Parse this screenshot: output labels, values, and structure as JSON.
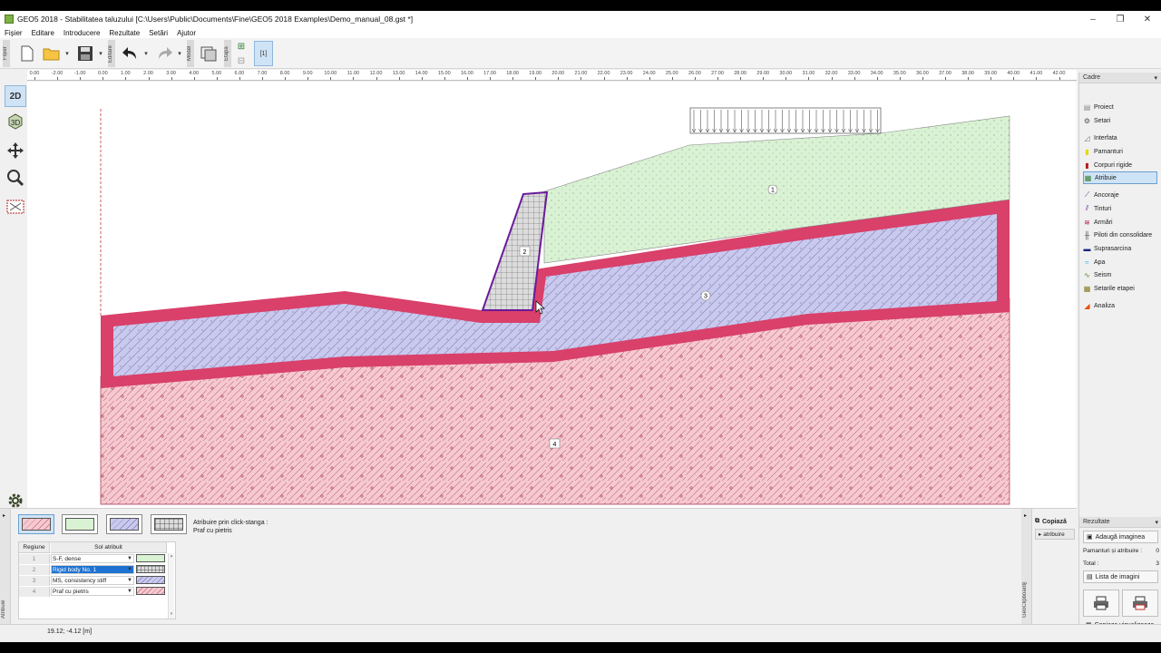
{
  "window": {
    "title": "GEO5 2018 - Stabilitatea taluzului [C:\\Users\\Public\\Documents\\Fine\\GEO5 2018 Examples\\Demo_manual_08.gst *]",
    "minimize": "–",
    "maximize": "❐",
    "close": "✕"
  },
  "menu": [
    "Fișier",
    "Editare",
    "Introducere",
    "Rezultate",
    "Setări",
    "Ajutor"
  ],
  "toolbar": {
    "group_file": "Fișier",
    "group_edit": "Editare",
    "group_model": "Model",
    "group_stage": "Etapă",
    "stage_label": "[1]"
  },
  "ruler": {
    "ticks": [
      "0.00",
      "-2.00",
      "-1.00",
      "0.00",
      "1.00",
      "2.00",
      "3.00",
      "4.00",
      "5.00",
      "6.00",
      "7.00",
      "8.00",
      "9.00",
      "10.00",
      "11.00",
      "12.00",
      "13.00",
      "14.00",
      "15.00",
      "16.00",
      "17.00",
      "18.00",
      "19.00",
      "20.00",
      "21.00",
      "22.00",
      "23.00",
      "24.00",
      "25.00",
      "26.00",
      "27.00",
      "28.00",
      "29.00",
      "30.00",
      "31.00",
      "32.00",
      "33.00",
      "34.00",
      "35.00",
      "36.00",
      "37.00",
      "38.00",
      "39.00",
      "40.00",
      "41.00",
      "42.00",
      "[m]"
    ]
  },
  "left_tools": {
    "view2d": "2D",
    "view3d": "3D"
  },
  "canvas": {
    "region_labels": [
      "1",
      "2",
      "3",
      "4"
    ]
  },
  "right_panel": {
    "header": "Cadre",
    "items": [
      {
        "label": "Proiect",
        "icon": "document-icon",
        "color": "#8a8a8a"
      },
      {
        "label": "Setari",
        "icon": "gear-icon",
        "color": "#555555"
      },
      {
        "label": "Interfata",
        "icon": "interface-icon",
        "color": "#777777"
      },
      {
        "label": "Pamanturi",
        "icon": "soils-icon",
        "color": "#e6d800"
      },
      {
        "label": "Corpuri rigide",
        "icon": "rigid-body-icon",
        "color": "#b71c1c"
      },
      {
        "label": "Atribuie",
        "icon": "assign-icon",
        "color": "#3a7d2c"
      },
      {
        "label": "Ancoraje",
        "icon": "anchor-icon",
        "color": "#6a1b9a"
      },
      {
        "label": "Tinturi",
        "icon": "nail-icon",
        "color": "#6a1b9a"
      },
      {
        "label": "Armări",
        "icon": "reinforcement-icon",
        "color": "#ad1457"
      },
      {
        "label": "Piloti din consolidare",
        "icon": "piles-icon",
        "color": "#444444"
      },
      {
        "label": "Suprasarcina",
        "icon": "surcharge-icon",
        "color": "#1a237e"
      },
      {
        "label": "Apa",
        "icon": "water-icon",
        "color": "#29b6f6"
      },
      {
        "label": "Seism",
        "icon": "earthquake-icon",
        "color": "#558b2f"
      },
      {
        "label": "Setarile etapei",
        "icon": "stage-settings-icon",
        "color": "#827717"
      },
      {
        "label": "Analiza",
        "icon": "analysis-icon",
        "color": "#e65100"
      }
    ],
    "results_header": "Rezultate",
    "add_image": "Adaugă imaginea",
    "soils_assign_label": "Pamanturi și atribuire :",
    "soils_assign_value": "0",
    "total_label": "Total :",
    "total_value": "3",
    "image_list": "Lista de imagini",
    "copy_view": "Copiaza vizualizeaza"
  },
  "bottom_panel": {
    "side_label": "Atribuie",
    "hint_line1": "Atribuire prin click-stanga :",
    "hint_line2": "Praf cu pietris",
    "table_header_region": "Regiune",
    "table_header_soil": "Sol atribuit",
    "rows": [
      {
        "num": "1",
        "soil": "S-F, dense"
      },
      {
        "num": "2",
        "soil": "Rigid body No. 1"
      },
      {
        "num": "3",
        "soil": "MS, consistency stiff"
      },
      {
        "num": "4",
        "soil": "Praf cu pietris"
      }
    ],
    "copy_title": "Copiază",
    "copy_btn": "atribuire",
    "clipboard_label": "GeoClipboard™"
  },
  "status": {
    "coords": "19.12; -4.12 [m]"
  },
  "colors": {
    "soil1": "#d9f2d3",
    "soil3": "#c9c9ee",
    "soil4": "#f6c9d0",
    "interface_band": "#d9406a",
    "rigid_fill": "#dcdcdc",
    "accent": "#cfe3f6"
  }
}
